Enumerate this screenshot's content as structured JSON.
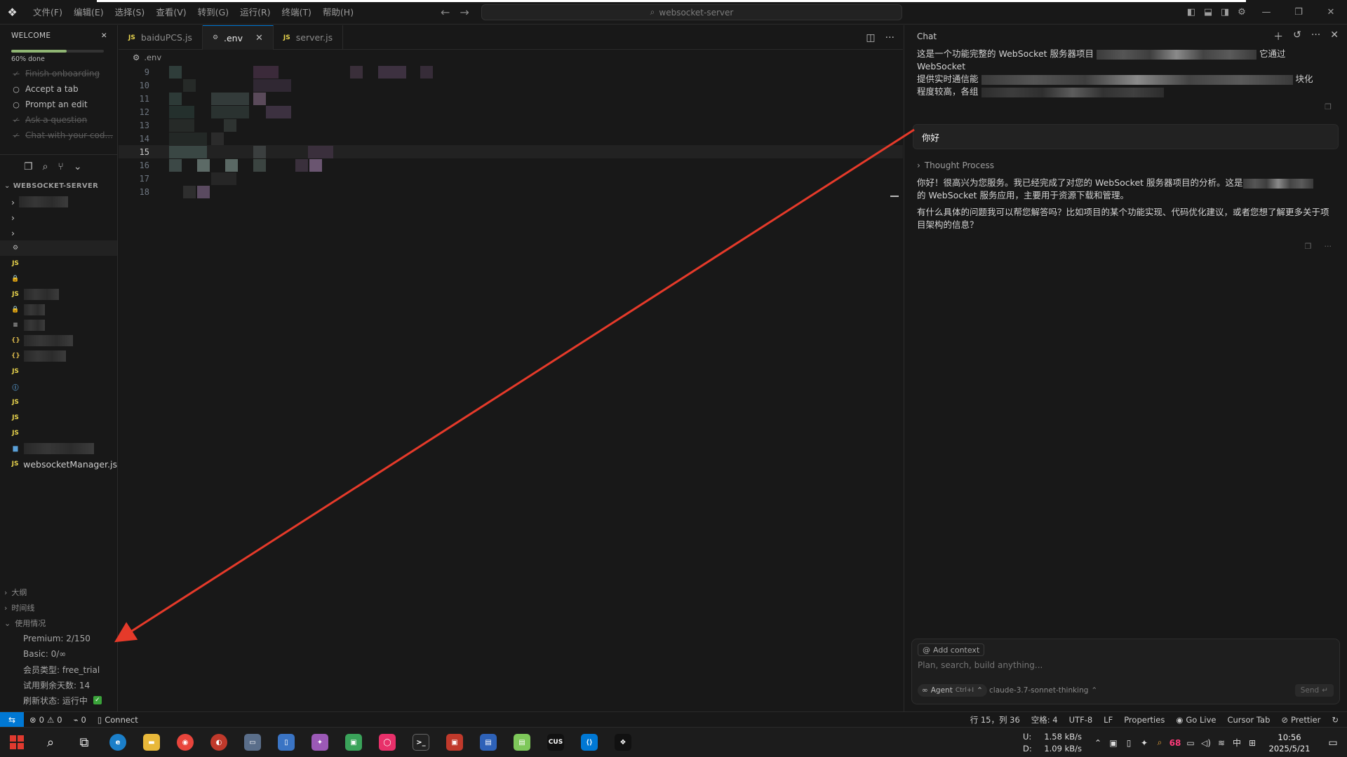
{
  "menu": [
    "文件(F)",
    "编辑(E)",
    "选择(S)",
    "查看(V)",
    "转到(G)",
    "运行(R)",
    "终端(T)",
    "帮助(H)"
  ],
  "search": {
    "text": "websocket-server"
  },
  "welcome": {
    "title": "WELCOME",
    "progress_label": "60% done",
    "progress": 0.6,
    "items": [
      {
        "label": "Finish onboarding",
        "done": true
      },
      {
        "label": "Accept a tab",
        "done": false
      },
      {
        "label": "Prompt an edit",
        "done": false
      },
      {
        "label": "Ask a question",
        "done": true
      },
      {
        "label": "Chat with your cod...",
        "done": true
      }
    ]
  },
  "explorer": {
    "title": "WEBSOCKET-SERVER",
    "last_file": "websocketManager.js"
  },
  "sections": {
    "outline": "大纲",
    "timeline": "时间线",
    "usage": "使用情况"
  },
  "usage": {
    "premium": "Premium: 2/150",
    "basic": "Basic: 0/∞",
    "member": "会员类型: free_trial",
    "trial_days": "试用剩余天数: 14",
    "refresh": "刷新状态: 运行中"
  },
  "tabs": [
    {
      "label": "baiduPCS.js",
      "icon": "JS"
    },
    {
      "label": ".env",
      "icon": "gear"
    },
    {
      "label": "server.js",
      "icon": "JS"
    }
  ],
  "breadcrumb": ".env",
  "line_numbers": [
    "9",
    "10",
    "11",
    "12",
    "13",
    "14",
    "15",
    "16",
    "17",
    "18"
  ],
  "current_line": "15",
  "chat": {
    "title": "Chat",
    "intro_a": "这是一个功能完整的 WebSocket 服务器项目",
    "intro_b": "它通过 WebSocket",
    "intro_c": "提供实时通信能",
    "intro_d": "块化",
    "intro_e": "程度较高，各组",
    "user_message": "你好",
    "thought": "Thought Process",
    "reply_1a": "你好！很高兴为您服务。我已经完成了对您的 WebSocket 服务器项目的分析。这是",
    "reply_1b": "的 WebSocket 服务应用，主要用于资源下载和管理。",
    "reply_2": "有什么具体的问题我可以帮您解答吗？比如项目的某个功能实现、代码优化建议，或者您想了解更多关于项目架构的信息？",
    "add_context": "Add context",
    "placeholder": "Plan, search, build anything...",
    "agent": "Agent",
    "agent_kbd": "Ctrl+I",
    "model": "claude-3.7-sonnet-thinking",
    "send": "Send"
  },
  "status": {
    "errors": "0",
    "warnings": "0",
    "ports": "0",
    "connect": "Connect",
    "position": "行 15，列 36",
    "spaces": "空格: 4",
    "encoding": "UTF-8",
    "eol": "LF",
    "lang": "Properties",
    "golive": "Go Live",
    "cursortab": "Cursor Tab",
    "prettier": "Prettier"
  },
  "taskbar": {
    "up_label": "U:",
    "up": "1.58 kB/s",
    "down_label": "D:",
    "down": "1.09 kB/s",
    "battery": "68",
    "ime": "中",
    "time": "10:56",
    "date": "2025/5/21"
  },
  "colors": {
    "accent": "#0078d4",
    "annotation": "#e53a2a",
    "progress": "#8fb573"
  }
}
